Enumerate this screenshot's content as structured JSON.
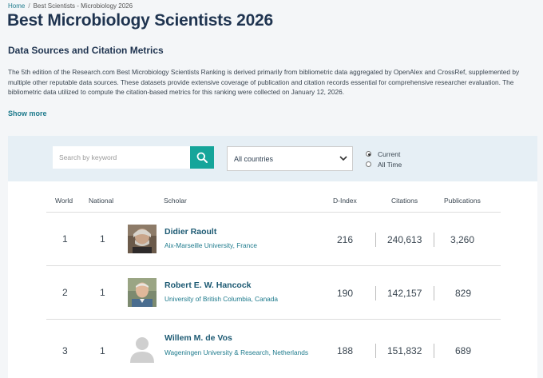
{
  "breadcrumb": {
    "home": "Home",
    "separator": "/",
    "current": "Best Scientists - Microbiology 2026"
  },
  "page_title": "Best Microbiology Scientists 2026",
  "section_title": "Data Sources and Citation Metrics",
  "description": "The 5th edition of the Research.com Best Microbiology Scientists Ranking is derived primarily from bibliometric data aggregated by OpenAlex and CrossRef, supplemented by multiple other reputable data sources. These datasets provide extensive coverage of publication and citation records essential for comprehensive researcher evaluation. The bibliometric data utilized to compute the citation-based metrics for this ranking were collected on January 12, 2026.",
  "show_more": "Show more",
  "search": {
    "placeholder": "Search by keyword"
  },
  "country_select": {
    "value": "All countries"
  },
  "radio": {
    "current": "Current",
    "all_time": "All Time",
    "selected": "current"
  },
  "columns": {
    "world": "World",
    "national": "National",
    "scholar": "Scholar",
    "dindex": "D-Index",
    "citations": "Citations",
    "publications": "Publications"
  },
  "rows": [
    {
      "world": "1",
      "national": "1",
      "name": "Didier Raoult",
      "affiliation": "Aix-Marseille University, France",
      "dindex": "216",
      "citations": "240,613",
      "publications": "3,260",
      "avatar": "photo"
    },
    {
      "world": "2",
      "national": "1",
      "name": "Robert E. W. Hancock",
      "affiliation": "University of British Columbia, Canada",
      "dindex": "190",
      "citations": "142,157",
      "publications": "829",
      "avatar": "photo"
    },
    {
      "world": "3",
      "national": "1",
      "name": "Willem M. de Vos",
      "affiliation": "Wageningen University & Research, Netherlands",
      "dindex": "188",
      "citations": "151,832",
      "publications": "689",
      "avatar": "placeholder"
    }
  ],
  "colors": {
    "accent": "#15a59a",
    "title": "#1f3450",
    "link": "#1d7a8c",
    "panel_bg": "#e6eff5"
  }
}
